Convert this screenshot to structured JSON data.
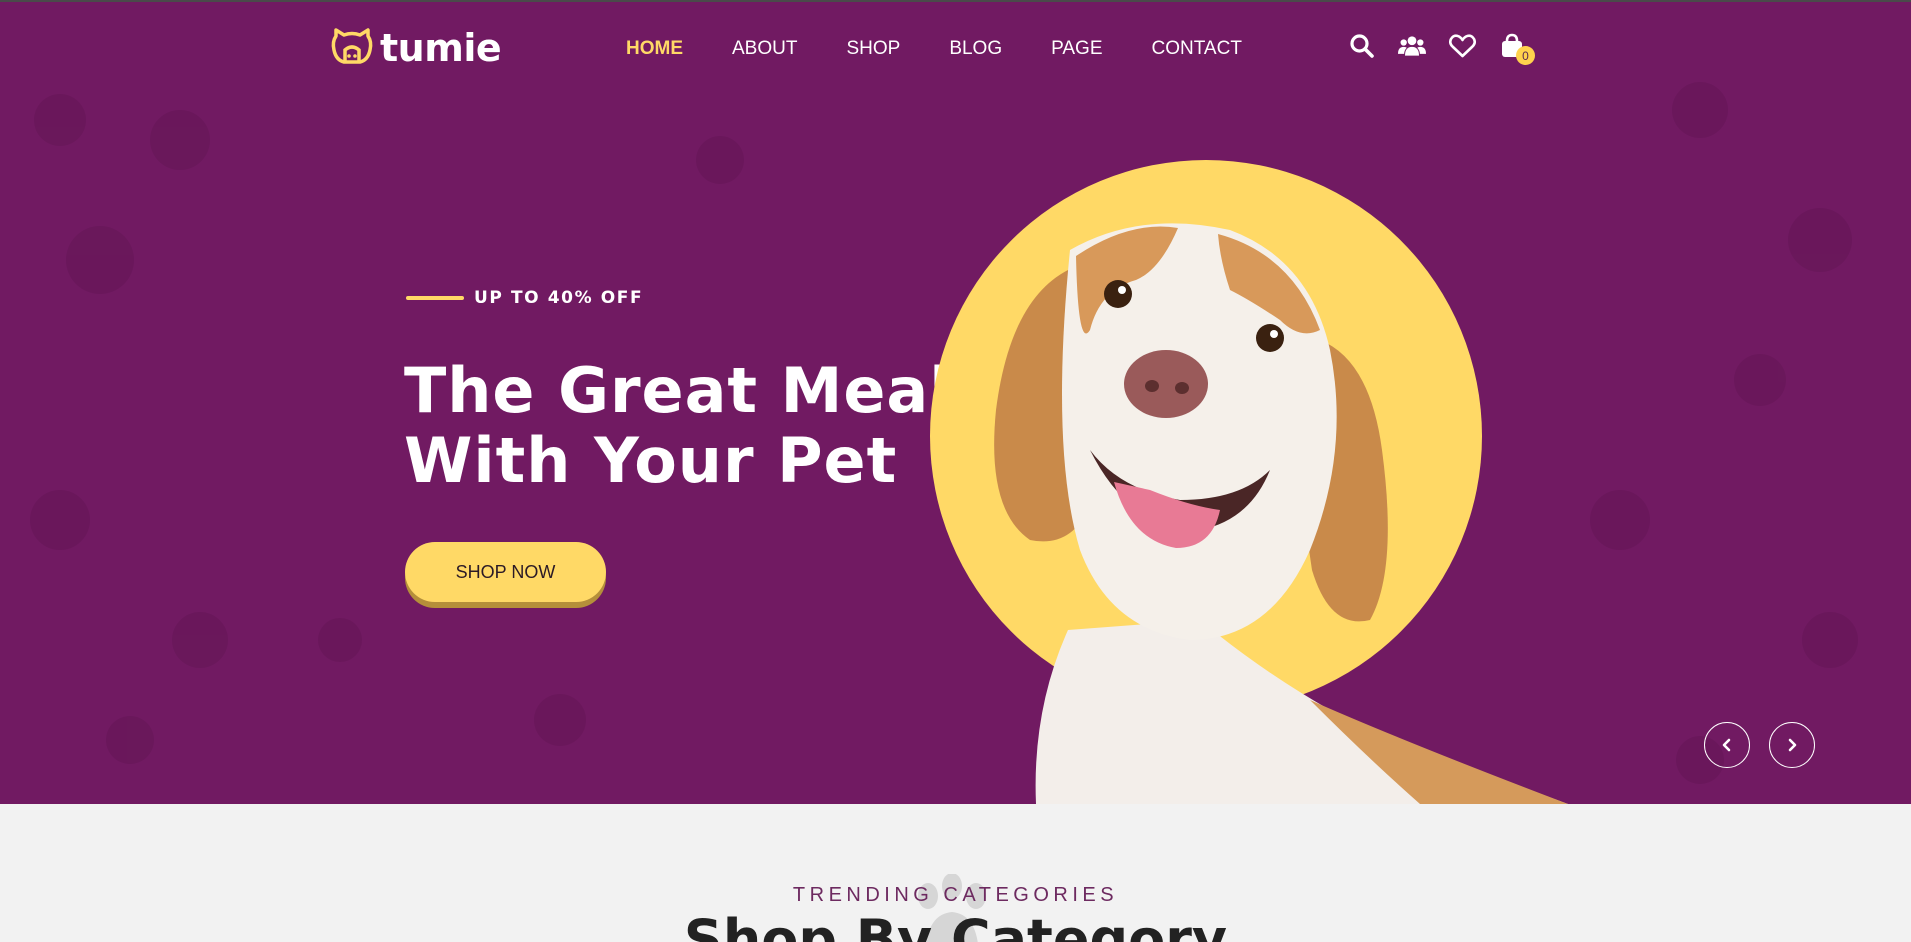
{
  "colors": {
    "hero_bg": "#711a62",
    "accent": "#ffd966",
    "text_light": "#ffffff",
    "section_bg": "#f2f2f2"
  },
  "brand": {
    "name": "tumie",
    "icon": "cat-face-logo-icon"
  },
  "nav": {
    "items": [
      {
        "label": "HOME",
        "active": true
      },
      {
        "label": "ABOUT"
      },
      {
        "label": "SHOP"
      },
      {
        "label": "BLOG"
      },
      {
        "label": "PAGE"
      },
      {
        "label": "CONTACT"
      }
    ]
  },
  "header_icons": {
    "search": "search-icon",
    "account": "users-icon",
    "wishlist": "heart-icon",
    "cart": "shopping-bag-icon",
    "cart_count": "0"
  },
  "hero": {
    "tag": "UP TO 40% OFF",
    "headline_line1": "The Great Meal",
    "headline_line2": "With Your Pet",
    "cta": "SHOP NOW",
    "image": "happy-dog-photo",
    "prev_icon": "chevron-left-icon",
    "next_icon": "chevron-right-icon"
  },
  "categories": {
    "subtitle": "TRENDING CATEGORIES",
    "title": "Shop By Category",
    "decor_icon": "paw-icon"
  }
}
